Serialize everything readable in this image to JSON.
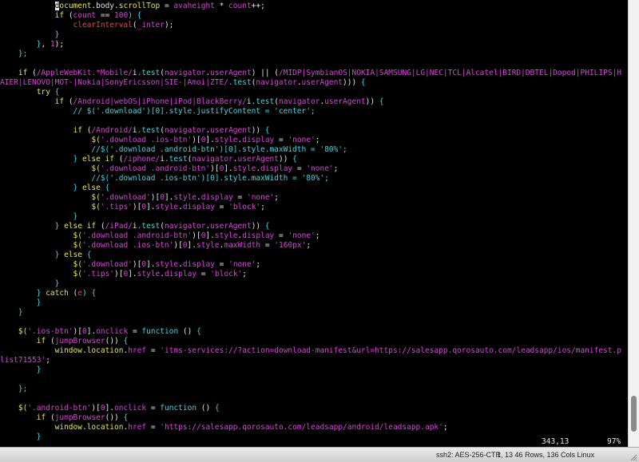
{
  "lines": [
    [
      {
        "t": "            ",
        "c": "w"
      },
      {
        "t": "d",
        "c": "cursor"
      },
      {
        "t": "ocument",
        "c": "y"
      },
      {
        "t": ".body.",
        "c": "w"
      },
      {
        "t": "scrollTop",
        "c": "y"
      },
      {
        "t": " = ",
        "c": "w"
      },
      {
        "t": "avaheight",
        "c": "m"
      },
      {
        "t": " * ",
        "c": "w"
      },
      {
        "t": "count",
        "c": "m"
      },
      {
        "t": "++;",
        "c": "w"
      }
    ],
    [
      {
        "t": "            ",
        "c": "w"
      },
      {
        "t": "if",
        "c": "y"
      },
      {
        "t": " (",
        "c": "w"
      },
      {
        "t": "count",
        "c": "m"
      },
      {
        "t": " == ",
        "c": "w"
      },
      {
        "t": "100",
        "c": "m"
      },
      {
        "t": ") {",
        "c": "c"
      }
    ],
    [
      {
        "t": "                ",
        "c": "w"
      },
      {
        "t": "clearInterval",
        "c": "r"
      },
      {
        "t": "(",
        "c": "w"
      },
      {
        "t": "_inter",
        "c": "m"
      },
      {
        "t": ");",
        "c": "w"
      }
    ],
    [
      {
        "t": "            }",
        "c": "c"
      }
    ],
    [
      {
        "t": "        }",
        "c": "c"
      },
      {
        "t": ", ",
        "c": "w"
      },
      {
        "t": "1",
        "c": "m"
      },
      {
        "t": ");",
        "c": "w"
      }
    ],
    [
      {
        "t": "    };",
        "c": "c"
      }
    ],
    [],
    [
      {
        "t": "    ",
        "c": "w"
      },
      {
        "t": "if",
        "c": "y"
      },
      {
        "t": " (",
        "c": "w"
      },
      {
        "t": "/AppleWebKit.*Mobile/",
        "c": "m"
      },
      {
        "t": "i",
        "c": "w"
      },
      {
        "t": ".test",
        "c": "c"
      },
      {
        "t": "(",
        "c": "w"
      },
      {
        "t": "navigator",
        "c": "m"
      },
      {
        "t": ".",
        "c": "w"
      },
      {
        "t": "userAgent",
        "c": "m"
      },
      {
        "t": ") || (",
        "c": "w"
      },
      {
        "t": "/MIDP|SymbianOS|NOKIA|SAMSUNG|LG|NEC|TCL|Alcatel|BIRD|DBTEL|Dopod|PHILIPS|H",
        "c": "m"
      }
    ],
    [
      {
        "t": "AIER|LENOVO|MOT-|Nokia|SonyEricsson|SIE-|Amoi|ZTE/",
        "c": "m"
      },
      {
        "t": ".test",
        "c": "c"
      },
      {
        "t": "(",
        "c": "w"
      },
      {
        "t": "navigator",
        "c": "m"
      },
      {
        "t": ".",
        "c": "w"
      },
      {
        "t": "userAgent",
        "c": "m"
      },
      {
        "t": "))) ",
        "c": "w"
      },
      {
        "t": "{",
        "c": "c"
      }
    ],
    [
      {
        "t": "        ",
        "c": "w"
      },
      {
        "t": "try",
        "c": "y"
      },
      {
        "t": " {",
        "c": "c"
      }
    ],
    [
      {
        "t": "            ",
        "c": "w"
      },
      {
        "t": "if",
        "c": "y"
      },
      {
        "t": " (",
        "c": "w"
      },
      {
        "t": "/Android|webOS|iPhone|iPod|BlackBerry/",
        "c": "m"
      },
      {
        "t": "i",
        "c": "w"
      },
      {
        "t": ".test",
        "c": "c"
      },
      {
        "t": "(",
        "c": "w"
      },
      {
        "t": "navigator",
        "c": "m"
      },
      {
        "t": ".",
        "c": "w"
      },
      {
        "t": "userAgent",
        "c": "m"
      },
      {
        "t": ")) ",
        "c": "w"
      },
      {
        "t": "{",
        "c": "c"
      }
    ],
    [
      {
        "t": "                // $('.download')[0].style.justifyContent = 'center';",
        "c": "c"
      }
    ],
    [],
    [
      {
        "t": "                ",
        "c": "w"
      },
      {
        "t": "if",
        "c": "y"
      },
      {
        "t": " (",
        "c": "w"
      },
      {
        "t": "/Android/",
        "c": "m"
      },
      {
        "t": "i",
        "c": "w"
      },
      {
        "t": ".test",
        "c": "c"
      },
      {
        "t": "(",
        "c": "w"
      },
      {
        "t": "navigator",
        "c": "m"
      },
      {
        "t": ".",
        "c": "w"
      },
      {
        "t": "userAgent",
        "c": "m"
      },
      {
        "t": ")) ",
        "c": "w"
      },
      {
        "t": "{",
        "c": "c"
      }
    ],
    [
      {
        "t": "                    ",
        "c": "w"
      },
      {
        "t": "$(",
        "c": "y"
      },
      {
        "t": "'.download .ios-btn'",
        "c": "m"
      },
      {
        "t": ")[",
        "c": "w"
      },
      {
        "t": "0",
        "c": "m"
      },
      {
        "t": "].",
        "c": "w"
      },
      {
        "t": "style",
        "c": "m"
      },
      {
        "t": ".",
        "c": "w"
      },
      {
        "t": "display",
        "c": "m"
      },
      {
        "t": " = ",
        "c": "w"
      },
      {
        "t": "'none'",
        "c": "m"
      },
      {
        "t": ";",
        "c": "w"
      }
    ],
    [
      {
        "t": "                    //$('.download .android-btn')[0].style.maxWidth = '80%';",
        "c": "c"
      }
    ],
    [
      {
        "t": "                } ",
        "c": "c"
      },
      {
        "t": "else if",
        "c": "y"
      },
      {
        "t": " (",
        "c": "w"
      },
      {
        "t": "/iphone/",
        "c": "m"
      },
      {
        "t": "i",
        "c": "w"
      },
      {
        "t": ".test",
        "c": "c"
      },
      {
        "t": "(",
        "c": "w"
      },
      {
        "t": "navigator",
        "c": "m"
      },
      {
        "t": ".",
        "c": "w"
      },
      {
        "t": "userAgent",
        "c": "m"
      },
      {
        "t": ")) ",
        "c": "w"
      },
      {
        "t": "{",
        "c": "c"
      }
    ],
    [
      {
        "t": "                    ",
        "c": "w"
      },
      {
        "t": "$(",
        "c": "y"
      },
      {
        "t": "'.download .android-btn'",
        "c": "m"
      },
      {
        "t": ")[",
        "c": "w"
      },
      {
        "t": "0",
        "c": "m"
      },
      {
        "t": "].",
        "c": "w"
      },
      {
        "t": "style",
        "c": "m"
      },
      {
        "t": ".",
        "c": "w"
      },
      {
        "t": "display",
        "c": "m"
      },
      {
        "t": " = ",
        "c": "w"
      },
      {
        "t": "'none'",
        "c": "m"
      },
      {
        "t": ";",
        "c": "w"
      }
    ],
    [
      {
        "t": "                    //$('.download .ios-btn')[0].style.maxWidth = '80%';",
        "c": "c"
      }
    ],
    [
      {
        "t": "                } ",
        "c": "c"
      },
      {
        "t": "else",
        "c": "y"
      },
      {
        "t": " {",
        "c": "c"
      }
    ],
    [
      {
        "t": "                    ",
        "c": "w"
      },
      {
        "t": "$(",
        "c": "y"
      },
      {
        "t": "'.download'",
        "c": "m"
      },
      {
        "t": ")[",
        "c": "w"
      },
      {
        "t": "0",
        "c": "m"
      },
      {
        "t": "].",
        "c": "w"
      },
      {
        "t": "style",
        "c": "m"
      },
      {
        "t": ".",
        "c": "w"
      },
      {
        "t": "display",
        "c": "m"
      },
      {
        "t": " = ",
        "c": "w"
      },
      {
        "t": "'none'",
        "c": "m"
      },
      {
        "t": ";",
        "c": "w"
      }
    ],
    [
      {
        "t": "                    ",
        "c": "w"
      },
      {
        "t": "$(",
        "c": "y"
      },
      {
        "t": "'.tips'",
        "c": "m"
      },
      {
        "t": ")[",
        "c": "w"
      },
      {
        "t": "0",
        "c": "m"
      },
      {
        "t": "].",
        "c": "w"
      },
      {
        "t": "style",
        "c": "m"
      },
      {
        "t": ".",
        "c": "w"
      },
      {
        "t": "display",
        "c": "m"
      },
      {
        "t": " = ",
        "c": "w"
      },
      {
        "t": "'block'",
        "c": "m"
      },
      {
        "t": ";",
        "c": "w"
      }
    ],
    [
      {
        "t": "                }",
        "c": "c"
      }
    ],
    [
      {
        "t": "            } ",
        "c": "c"
      },
      {
        "t": "else if",
        "c": "y"
      },
      {
        "t": " (",
        "c": "w"
      },
      {
        "t": "/iPad/",
        "c": "m"
      },
      {
        "t": "i",
        "c": "w"
      },
      {
        "t": ".test",
        "c": "c"
      },
      {
        "t": "(",
        "c": "w"
      },
      {
        "t": "navigator",
        "c": "m"
      },
      {
        "t": ".",
        "c": "w"
      },
      {
        "t": "userAgent",
        "c": "m"
      },
      {
        "t": ")) ",
        "c": "w"
      },
      {
        "t": "{",
        "c": "c"
      }
    ],
    [
      {
        "t": "                ",
        "c": "w"
      },
      {
        "t": "$(",
        "c": "y"
      },
      {
        "t": "'.download .android-btn'",
        "c": "m"
      },
      {
        "t": ")[",
        "c": "w"
      },
      {
        "t": "0",
        "c": "m"
      },
      {
        "t": "].",
        "c": "w"
      },
      {
        "t": "style",
        "c": "m"
      },
      {
        "t": ".",
        "c": "w"
      },
      {
        "t": "display",
        "c": "m"
      },
      {
        "t": " = ",
        "c": "w"
      },
      {
        "t": "'none'",
        "c": "m"
      },
      {
        "t": ";",
        "c": "w"
      }
    ],
    [
      {
        "t": "                ",
        "c": "w"
      },
      {
        "t": "$(",
        "c": "y"
      },
      {
        "t": "'.download .ios-btn'",
        "c": "m"
      },
      {
        "t": ")[",
        "c": "w"
      },
      {
        "t": "0",
        "c": "m"
      },
      {
        "t": "].",
        "c": "w"
      },
      {
        "t": "style",
        "c": "m"
      },
      {
        "t": ".",
        "c": "w"
      },
      {
        "t": "maxWidth",
        "c": "m"
      },
      {
        "t": " = ",
        "c": "w"
      },
      {
        "t": "'160px'",
        "c": "m"
      },
      {
        "t": ";",
        "c": "w"
      }
    ],
    [
      {
        "t": "            } ",
        "c": "c"
      },
      {
        "t": "else",
        "c": "y"
      },
      {
        "t": " {",
        "c": "c"
      }
    ],
    [
      {
        "t": "                ",
        "c": "w"
      },
      {
        "t": "$(",
        "c": "y"
      },
      {
        "t": "'.download'",
        "c": "m"
      },
      {
        "t": ")[",
        "c": "w"
      },
      {
        "t": "0",
        "c": "m"
      },
      {
        "t": "].",
        "c": "w"
      },
      {
        "t": "style",
        "c": "m"
      },
      {
        "t": ".",
        "c": "w"
      },
      {
        "t": "display",
        "c": "m"
      },
      {
        "t": " = ",
        "c": "w"
      },
      {
        "t": "'none'",
        "c": "m"
      },
      {
        "t": ";",
        "c": "w"
      }
    ],
    [
      {
        "t": "                ",
        "c": "w"
      },
      {
        "t": "$(",
        "c": "y"
      },
      {
        "t": "'.tips'",
        "c": "m"
      },
      {
        "t": ")[",
        "c": "w"
      },
      {
        "t": "0",
        "c": "m"
      },
      {
        "t": "].",
        "c": "w"
      },
      {
        "t": "style",
        "c": "m"
      },
      {
        "t": ".",
        "c": "w"
      },
      {
        "t": "display",
        "c": "m"
      },
      {
        "t": " = ",
        "c": "w"
      },
      {
        "t": "'block'",
        "c": "m"
      },
      {
        "t": ";",
        "c": "w"
      }
    ],
    [
      {
        "t": "            }",
        "c": "c"
      }
    ],
    [
      {
        "t": "        } ",
        "c": "c"
      },
      {
        "t": "catch",
        "c": "y"
      },
      {
        "t": " (",
        "c": "w"
      },
      {
        "t": "e",
        "c": "r"
      },
      {
        "t": ") {",
        "c": "c"
      }
    ],
    [
      {
        "t": "        }",
        "c": "c"
      }
    ],
    [
      {
        "t": "    }",
        "c": "c"
      }
    ],
    [],
    [
      {
        "t": "    ",
        "c": "w"
      },
      {
        "t": "$(",
        "c": "y"
      },
      {
        "t": "'.ios-btn'",
        "c": "m"
      },
      {
        "t": ")[",
        "c": "w"
      },
      {
        "t": "0",
        "c": "m"
      },
      {
        "t": "].",
        "c": "w"
      },
      {
        "t": "onclick",
        "c": "m"
      },
      {
        "t": " = ",
        "c": "w"
      },
      {
        "t": "function",
        "c": "c"
      },
      {
        "t": " () ",
        "c": "w"
      },
      {
        "t": "{",
        "c": "c"
      }
    ],
    [
      {
        "t": "        ",
        "c": "w"
      },
      {
        "t": "if",
        "c": "y"
      },
      {
        "t": " (",
        "c": "w"
      },
      {
        "t": "jumpBrowser",
        "c": "m"
      },
      {
        "t": "()) ",
        "c": "w"
      },
      {
        "t": "{",
        "c": "c"
      }
    ],
    [
      {
        "t": "            ",
        "c": "w"
      },
      {
        "t": "window",
        "c": "y"
      },
      {
        "t": ".",
        "c": "w"
      },
      {
        "t": "location",
        "c": "y"
      },
      {
        "t": ".",
        "c": "w"
      },
      {
        "t": "href",
        "c": "m"
      },
      {
        "t": " = ",
        "c": "w"
      },
      {
        "t": "'itms-services://?action=download-manifest&url=https://salesapp.qorosauto.com/leadsapp/ios/manifest.p",
        "c": "m"
      }
    ],
    [
      {
        "t": "list71553'",
        "c": "m"
      },
      {
        "t": ";",
        "c": "w"
      }
    ],
    [
      {
        "t": "        }",
        "c": "c"
      }
    ],
    [],
    [
      {
        "t": "    };",
        "c": "c"
      }
    ],
    [],
    [
      {
        "t": "    ",
        "c": "w"
      },
      {
        "t": "$(",
        "c": "y"
      },
      {
        "t": "'.android-btn'",
        "c": "m"
      },
      {
        "t": ")[",
        "c": "w"
      },
      {
        "t": "0",
        "c": "m"
      },
      {
        "t": "].",
        "c": "w"
      },
      {
        "t": "onclick",
        "c": "m"
      },
      {
        "t": " = ",
        "c": "w"
      },
      {
        "t": "function",
        "c": "c"
      },
      {
        "t": " () ",
        "c": "w"
      },
      {
        "t": "{",
        "c": "c"
      }
    ],
    [
      {
        "t": "        ",
        "c": "w"
      },
      {
        "t": "if",
        "c": "y"
      },
      {
        "t": " (",
        "c": "w"
      },
      {
        "t": "jumpBrowser",
        "c": "m"
      },
      {
        "t": "()) ",
        "c": "w"
      },
      {
        "t": "{",
        "c": "c"
      }
    ],
    [
      {
        "t": "            ",
        "c": "w"
      },
      {
        "t": "window",
        "c": "y"
      },
      {
        "t": ".",
        "c": "w"
      },
      {
        "t": "location",
        "c": "y"
      },
      {
        "t": ".",
        "c": "w"
      },
      {
        "t": "href",
        "c": "m"
      },
      {
        "t": " = ",
        "c": "w"
      },
      {
        "t": "'https://salesapp.qorosauto.com/leadsapp/android/leadsapp.apk'",
        "c": "m"
      },
      {
        "t": ";",
        "c": "w"
      }
    ],
    [
      {
        "t": "        }",
        "c": "c"
      }
    ]
  ],
  "vim": {
    "ruler_position": "343,13",
    "ruler_percent": "97%"
  },
  "statusbar": {
    "session": "ssh2: AES-256-CTR",
    "dimensions": "1, 13  46 Rows, 136 Cols  Linux"
  },
  "scroll_position_fraction": 0.97,
  "colors": {
    "background": "#000000",
    "text": "#e6e6e6",
    "keyword": "#e8e84a",
    "brace_comment": "#3fd7e0",
    "string_identifier": "#e23ce2",
    "function_call": "#e14a4a"
  }
}
